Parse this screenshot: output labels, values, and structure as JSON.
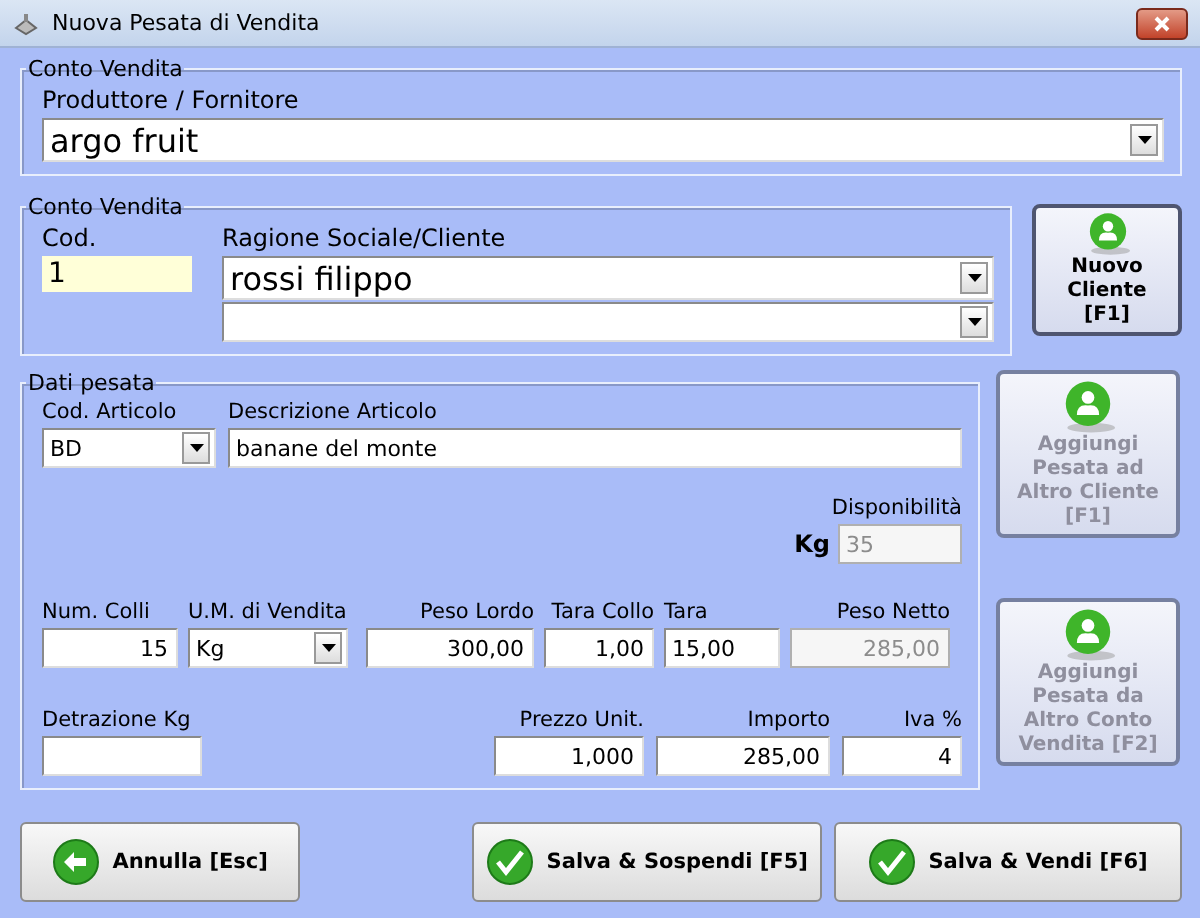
{
  "window": {
    "title": "Nuova Pesata di Vendita"
  },
  "supplier_section": {
    "legend": "Conto Vendita",
    "label": "Produttore / Fornitore",
    "value": "argo fruit"
  },
  "client_section": {
    "legend": "Conto Vendita",
    "code": {
      "label": "Cod.",
      "value": "1",
      "focused": true
    },
    "client": {
      "label": "Ragione Sociale/Cliente",
      "value": "rossi filippo"
    }
  },
  "new_client_button": {
    "label": "Nuovo Cliente [F1]",
    "disabled": false
  },
  "weighing": {
    "legend": "Dati pesata",
    "article_code": {
      "label": "Cod. Articolo",
      "value": "BD"
    },
    "description": {
      "label": "Descrizione Articolo",
      "value": "banane del monte"
    },
    "availability": {
      "label": "Disponibilità",
      "unit": "Kg",
      "value": "35",
      "disabled": true
    },
    "fields": [
      {
        "label": "Num. Colli",
        "value": "15",
        "kind": "number",
        "disabled": false
      },
      {
        "label": "U.M. di Vendita",
        "value": "Kg",
        "kind": "select",
        "disabled": false
      },
      {
        "label": "Peso Lordo",
        "value": "300,00",
        "kind": "number",
        "disabled": false
      },
      {
        "label": "Tara Collo",
        "value": "1,00",
        "kind": "number",
        "disabled": false
      },
      {
        "label": "Tara",
        "value": "15,00",
        "kind": "text",
        "disabled": false
      },
      {
        "label": "Peso Netto",
        "value": "285,00",
        "kind": "number",
        "disabled": true
      }
    ],
    "totals": [
      {
        "label": "Detrazione Kg",
        "kind": "text"
      },
      {
        "label": "Prezzo Unit.",
        "value": "1,000",
        "kind": "number"
      },
      {
        "label": "Importo",
        "value": "285,00",
        "kind": "number"
      },
      {
        "label": "Iva %",
        "value": "4",
        "kind": "number"
      }
    ]
  },
  "side_buttons": [
    {
      "label": "Aggiungi Pesata ad Altro Cliente [F1]",
      "disabled": true
    },
    {
      "label": "Aggiungi Pesata da Altro Conto Vendita [F2]",
      "disabled": true
    }
  ],
  "footer_buttons": [
    {
      "label": "Annulla [Esc]",
      "kind": "back"
    },
    {
      "label": "Salva & Sospendi [F5]",
      "kind": "confirm"
    },
    {
      "label": "Salva & Vendi [F6]",
      "kind": "confirm"
    }
  ]
}
